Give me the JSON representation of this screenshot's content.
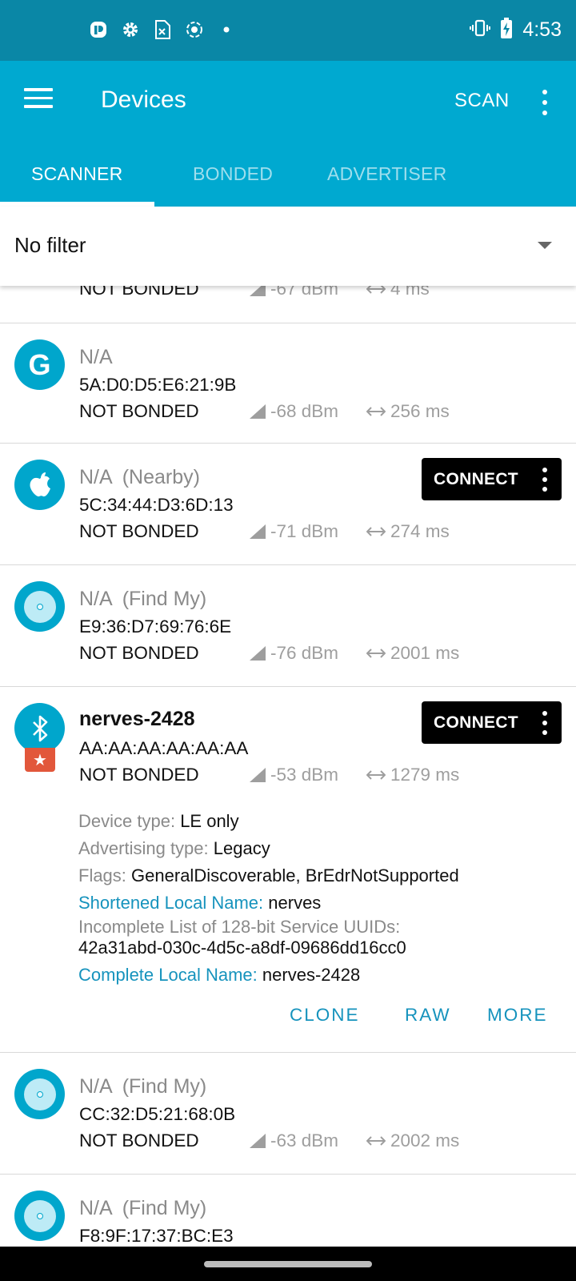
{
  "status_bar": {
    "time": "4:53"
  },
  "app_bar": {
    "title": "Devices",
    "scan_label": "SCAN"
  },
  "tabs": [
    {
      "label": "SCANNER"
    },
    {
      "label": "BONDED"
    },
    {
      "label": "ADVERTISER"
    }
  ],
  "filter": {
    "label": "No filter"
  },
  "partial_row": {
    "bond": "NOT BONDED",
    "rssi": "-67 dBm",
    "interval": "4 ms"
  },
  "devices": [
    {
      "icon": "google-icon",
      "name": "N/A",
      "extra": "",
      "address": "5A:D0:D5:E6:21:9B",
      "bond": "NOT BONDED",
      "rssi": "-68 dBm",
      "interval": "256 ms"
    },
    {
      "icon": "apple-icon",
      "name": "N/A",
      "extra": "(Nearby)",
      "address": "5C:34:44:D3:6D:13",
      "bond": "NOT BONDED",
      "rssi": "-71 dBm",
      "interval": "274 ms",
      "connect_label": "CONNECT"
    },
    {
      "icon": "findmy-icon",
      "name": "N/A",
      "extra": "(Find My)",
      "address": "E9:36:D7:69:76:6E",
      "bond": "NOT BONDED",
      "rssi": "-76 dBm",
      "interval": "2001 ms"
    },
    {
      "icon": "bluetooth-icon",
      "name": "nerves-2428",
      "extra": "",
      "address": "AA:AA:AA:AA:AA:AA",
      "bond": "NOT BONDED",
      "rssi": "-53 dBm",
      "interval": "1279 ms",
      "connect_label": "CONNECT",
      "details": {
        "device_type_key": "Device type:",
        "device_type_val": "LE only",
        "adv_type_key": "Advertising type:",
        "adv_type_val": "Legacy",
        "flags_key": "Flags:",
        "flags_val": "GeneralDiscoverable, BrEdrNotSupported",
        "short_name_key": "Shortened Local Name:",
        "short_name_val": "nerves",
        "uuids_key": "Incomplete List of 128-bit Service UUIDs:",
        "uuids_val": "42a31abd-030c-4d5c-a8df-09686dd16cc0",
        "complete_name_key": "Complete Local Name:",
        "complete_name_val": "nerves-2428"
      },
      "actions": {
        "clone": "CLONE",
        "raw": "RAW",
        "more": "MORE"
      }
    },
    {
      "icon": "findmy-icon",
      "name": "N/A",
      "extra": "(Find My)",
      "address": "CC:32:D5:21:68:0B",
      "bond": "NOT BONDED",
      "rssi": "-63 dBm",
      "interval": "2002 ms"
    },
    {
      "icon": "findmy-icon",
      "name": "N/A",
      "extra": "(Find My)",
      "address": "F8:9F:17:37:BC:E3"
    }
  ],
  "colors": {
    "status_bar": "#0a87a6",
    "app_bar": "#00a9d0",
    "accent": "#1693bd",
    "badge": "#e2573b"
  }
}
